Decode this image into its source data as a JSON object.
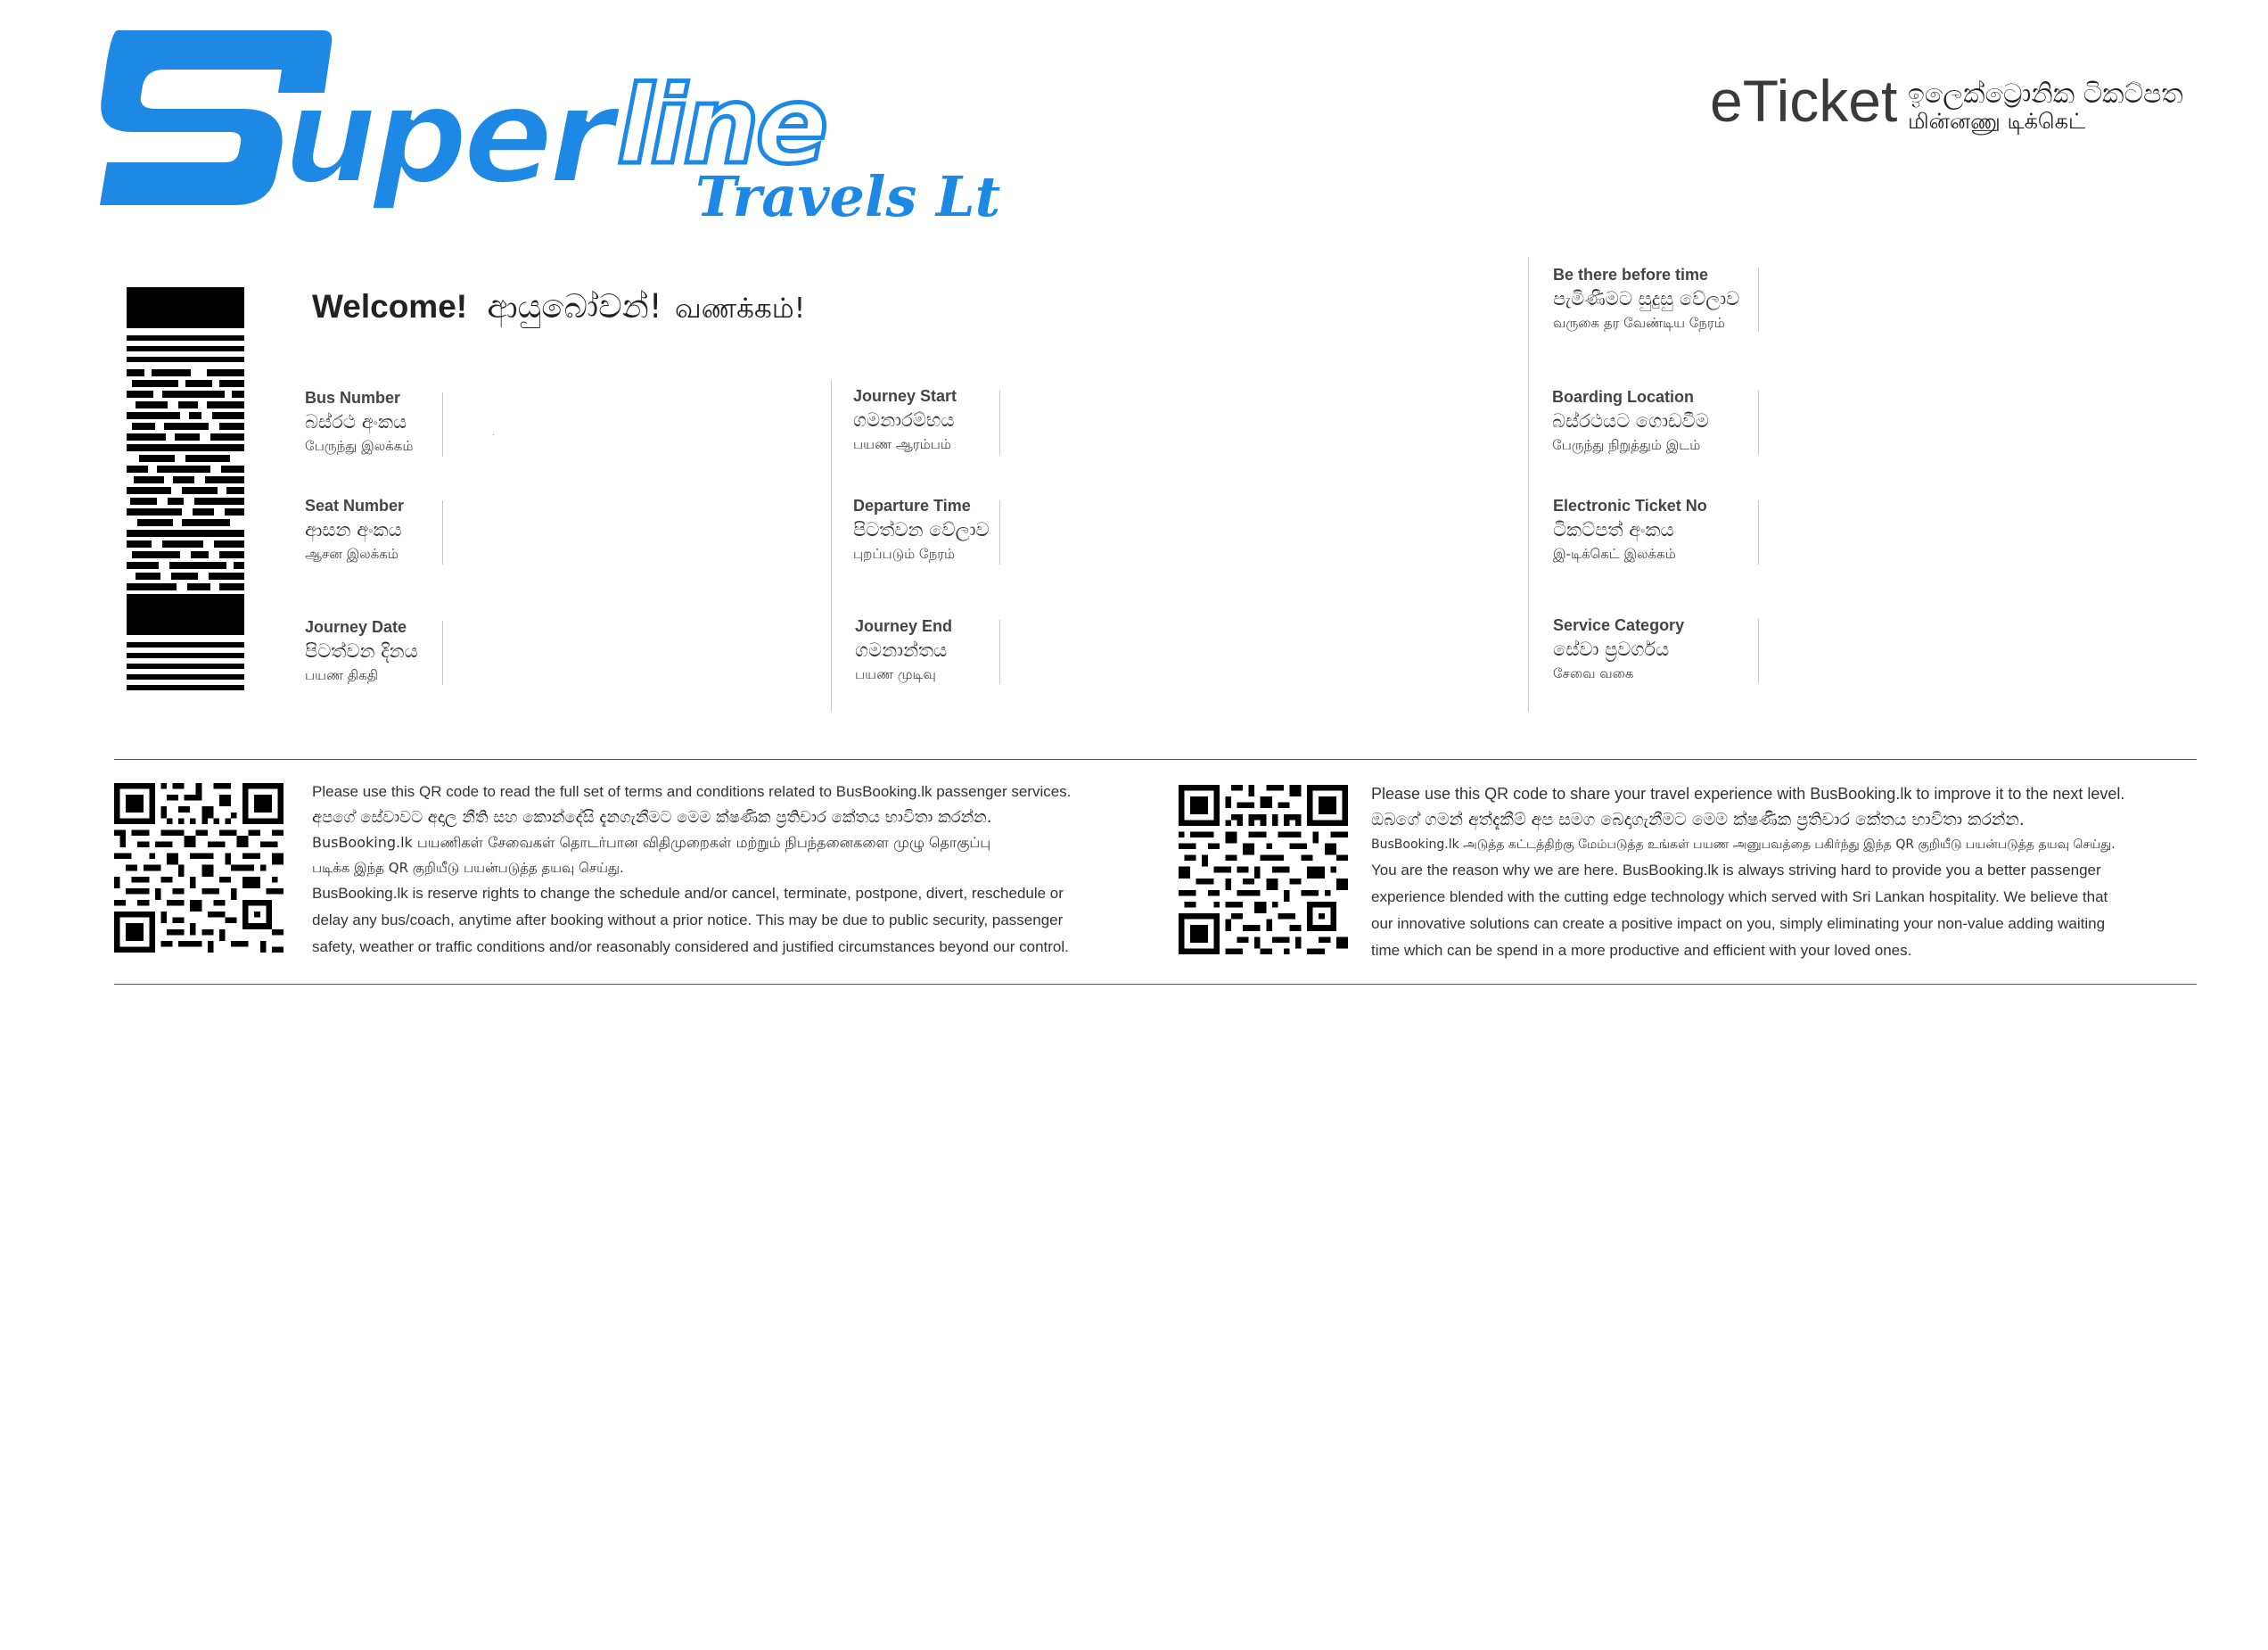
{
  "logo": {
    "primary": "Superline",
    "secondary": "Travels Ltd",
    "color": "#1e88e5"
  },
  "header": {
    "title_en": "eTicket",
    "title_si": "ඉලෙක්ට්‍රොනික ටිකට්පත",
    "title_ta": "மின்னணு டிக்கெட்"
  },
  "welcome": {
    "en": "Welcome!",
    "si": "ආයුබෝවන්!",
    "ta": "வணக்கம்!"
  },
  "fields": {
    "bus_number": {
      "en": "Bus Number",
      "si": "බස්රථ අංකය",
      "ta": "பேருந்து இலக்கம்",
      "value": "."
    },
    "seat_number": {
      "en": "Seat Number",
      "si": "ආසන අංකය",
      "ta": "ஆசன இலக்கம்",
      "value": ""
    },
    "journey_date": {
      "en": "Journey Date",
      "si": "පිටත්වන දිනය",
      "ta": "பயண திகதி",
      "value": ""
    },
    "journey_start": {
      "en": "Journey Start",
      "si": "ගමනාරම්භය",
      "ta": "பயண ஆரம்பம்",
      "value": ""
    },
    "departure_time": {
      "en": "Departure Time",
      "si": "පිටත්වන වේලාව",
      "ta": "புறப்படும் நேரம்",
      "value": ""
    },
    "journey_end": {
      "en": "Journey End",
      "si": "ගමනාන්තය",
      "ta": "பயண முடிவு",
      "value": ""
    },
    "be_there": {
      "en": "Be there before time",
      "si": "පැමිණීමට සුදුසු වේලාව",
      "ta": "வருகை தர வேண்டிய நேரம்",
      "value": ""
    },
    "boarding_location": {
      "en": "Boarding Location",
      "si": "බස්රථයට ගොඩවීම",
      "ta": "பேருந்து நிறுத்தும் இடம்",
      "value": ""
    },
    "eticket_no": {
      "en": "Electronic Ticket No",
      "si": "ටිකට්පත් අංකය",
      "ta": "இ-டிக்கெட் இலக்கம்",
      "value": ""
    },
    "service_category": {
      "en": "Service Category",
      "si": "සේවා ප්‍රවර්ගය",
      "ta": "சேவை வகை",
      "value": ""
    }
  },
  "terms": {
    "line1": "Please use this QR code to read the full set of terms and conditions related to BusBooking.lk passenger services.",
    "line_si": "අපගේ සේවාවට අදාල නීති සහ කොන්දේසි දැනගැනීමට මෙම ක්ෂණික ප්‍රතිචාර කේතය භාවිතා කරන්න.",
    "line_ta_1": "BusBooking.lk பயணிகள் சேவைகள் தொடர்பான விதிமுறைகள் மற்றும் நிபந்தனைகளை முழு தொகுப்பு",
    "line_ta_2": "படிக்க இந்த QR குறியீடு பயன்படுத்த தயவு செய்து.",
    "rights_1": "BusBooking.lk is reserve rights to change the schedule and/or cancel, terminate, postpone, divert, reschedule or",
    "rights_2": "delay any bus/coach, anytime after booking without a prior notice. This may be due to public security, passenger",
    "rights_3": "safety, weather or traffic conditions and/or reasonably considered and justified circumstances beyond our control."
  },
  "feedback": {
    "line1": "Please use this QR code to share your travel experience with BusBooking.lk to improve it to the next level.",
    "line_si": "ඔබගේ ගමන් අත්දැකීම් අප සමග බෙදාගැනීමට මෙම ක්ෂණික ප්‍රතිචාර කේතය භාවිතා කරන්න.",
    "line_ta": "BusBooking.lk அடுத்த கட்டத்திற்கு மேம்படுத்த உங்கள் பயண அனுபவத்தை பகிர்ந்து இந்த QR குறியீடு பயன்படுத்த தயவு செய்து.",
    "body_1": "You are the reason why we are here. BusBooking.lk is always striving hard to provide you a better passenger",
    "body_2": "experience blended with the cutting edge technology which served with Sri Lankan hospitality. We believe that",
    "body_3": "our innovative solutions can create a positive impact on you, simply eliminating your non-value adding waiting",
    "body_4": "time which can be spend in a more productive and efficient with your loved ones."
  }
}
